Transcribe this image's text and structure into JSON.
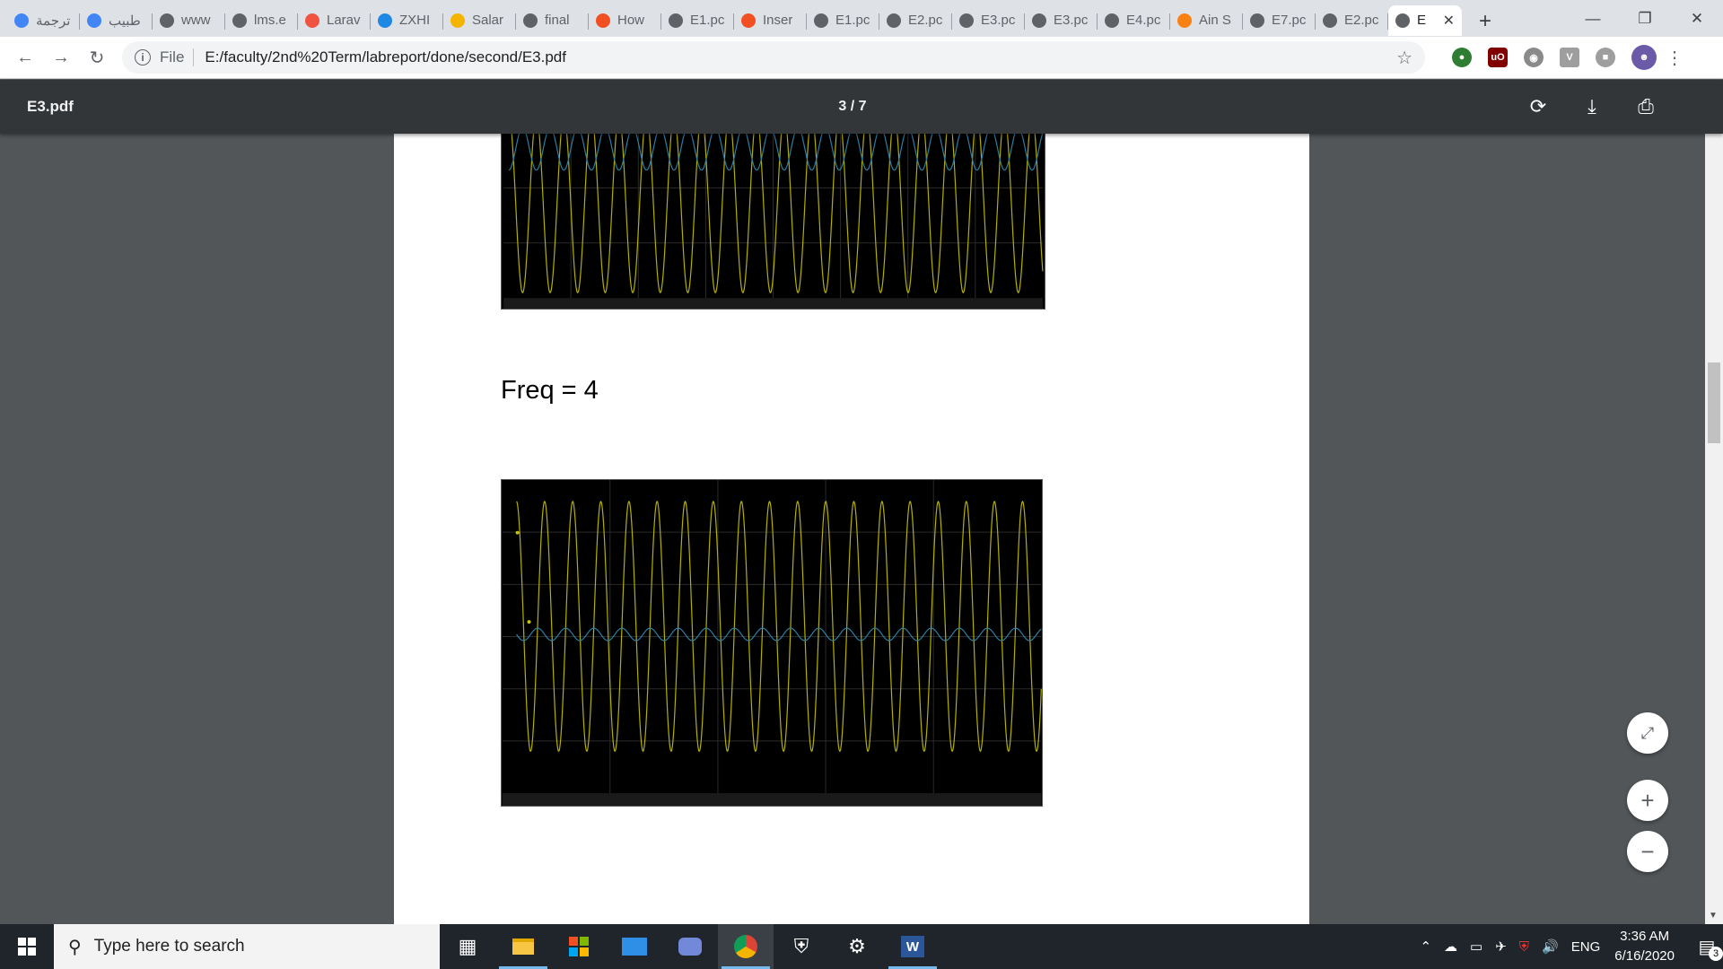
{
  "browser": {
    "tabs": [
      {
        "label": "ترجمة",
        "icon": "google-translate-icon",
        "color": "#4285f4"
      },
      {
        "label": "طبيب",
        "icon": "google-icon",
        "color": "#4285f4"
      },
      {
        "label": "www",
        "icon": "globe-icon",
        "color": "#5f6368"
      },
      {
        "label": "lms.e",
        "icon": "globe-icon",
        "color": "#5f6368"
      },
      {
        "label": "Larav",
        "icon": "laravel-icon",
        "color": "#f05340"
      },
      {
        "label": "ZXHI",
        "icon": "zte-icon",
        "color": "#1e88e5"
      },
      {
        "label": "Salar",
        "icon": "flame-icon",
        "color": "#f4b400"
      },
      {
        "label": "final",
        "icon": "globe-icon",
        "color": "#5f6368"
      },
      {
        "label": "How",
        "icon": "microsoft-icon",
        "color": "#f25022"
      },
      {
        "label": "E1.pc",
        "icon": "globe-icon",
        "color": "#5f6368"
      },
      {
        "label": "Inser",
        "icon": "microsoft-icon",
        "color": "#f25022"
      },
      {
        "label": "E1.pc",
        "icon": "globe-icon",
        "color": "#5f6368"
      },
      {
        "label": "E2.pc",
        "icon": "globe-icon",
        "color": "#5f6368"
      },
      {
        "label": "E3.pc",
        "icon": "globe-icon",
        "color": "#5f6368"
      },
      {
        "label": "E3.pc",
        "icon": "globe-icon",
        "color": "#5f6368"
      },
      {
        "label": "E4.pc",
        "icon": "globe-icon",
        "color": "#5f6368"
      },
      {
        "label": "Ain S",
        "icon": "moodle-icon",
        "color": "#f98012"
      },
      {
        "label": "E7.pc",
        "icon": "globe-icon",
        "color": "#5f6368"
      },
      {
        "label": "E2.pc",
        "icon": "globe-icon",
        "color": "#5f6368"
      },
      {
        "label": "E",
        "icon": "globe-icon",
        "color": "#5f6368",
        "active": true
      }
    ],
    "new_tab": "+",
    "address": {
      "scheme_label": "File",
      "url": "E:/faculty/2nd%20Term/labreport/done/second/E3.pdf"
    }
  },
  "pdf": {
    "filename": "E3.pdf",
    "page_indicator": "3 / 7",
    "heading": "Freq = 4"
  },
  "colors": {
    "yellow_trace": "#b5b000",
    "blue_trace": "#2a7fa8",
    "grid": "#2b2b2b",
    "page_bg": "#525659",
    "pdfbar": "#323639"
  },
  "taskbar": {
    "search_placeholder": "Type here to search",
    "language": "ENG",
    "time": "3:36 AM",
    "date": "6/16/2020",
    "notifications": "3"
  }
}
